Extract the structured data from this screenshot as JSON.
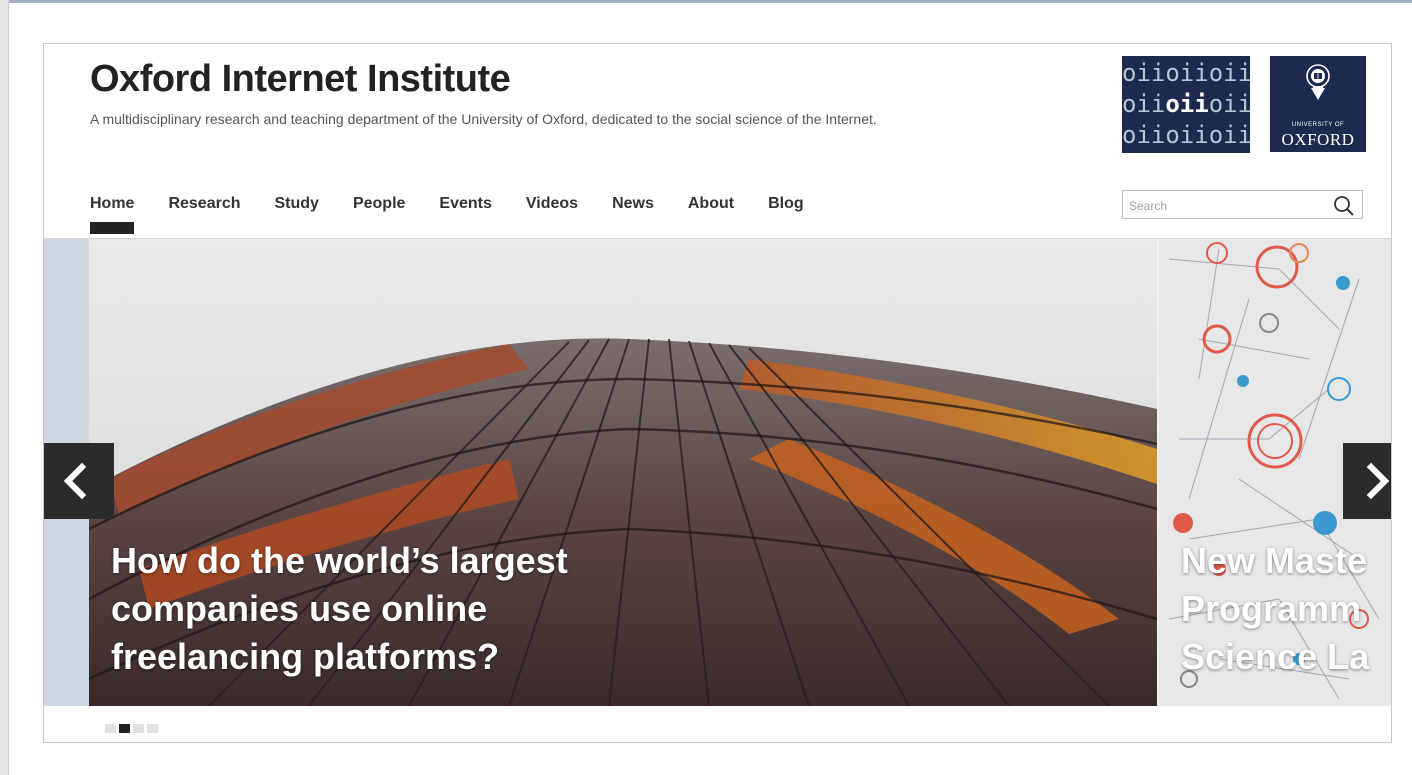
{
  "site": {
    "title": "Oxford Internet Institute",
    "tagline": "A multidisciplinary research and teaching department of the University of Oxford, dedicated to the social science of the Internet."
  },
  "logos": {
    "oii_rows": [
      [
        "oii",
        "oii",
        "oii"
      ],
      [
        "oii",
        "oii",
        "oii"
      ],
      [
        "oii",
        "oii",
        "oii"
      ]
    ],
    "university_of": "UNIVERSITY OF",
    "oxford": "OXFORD"
  },
  "nav": {
    "items": [
      "Home",
      "Research",
      "Study",
      "People",
      "Events",
      "Videos",
      "News",
      "About",
      "Blog"
    ],
    "active": "Home"
  },
  "search": {
    "placeholder": "Search",
    "value": ""
  },
  "carousel": {
    "slides": [
      {
        "caption": "How do the world’s largest companies use online freelancing platforms?"
      },
      {
        "caption": "New Maste Programme Science La"
      }
    ],
    "next_caption_lines": [
      "New Maste",
      "Programm",
      "Science La"
    ],
    "main_caption_lines": [
      "How do the world’s largest",
      "companies use online",
      "freelancing platforms?"
    ],
    "indicator_count": 4,
    "active_indicator": 2
  },
  "colors": {
    "brand_navy": "#1b2a4e",
    "dark_control": "#2b2b2b",
    "text": "#222222"
  },
  "icons": {
    "prev": "chevron-left-icon",
    "next": "chevron-right-icon",
    "search": "search-icon",
    "info": "info-icon"
  }
}
